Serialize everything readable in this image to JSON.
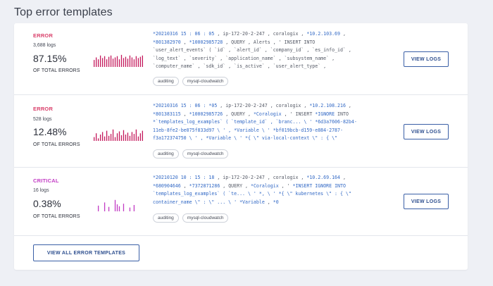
{
  "page": {
    "title": "Top error templates"
  },
  "templates": [
    {
      "severity": "ERROR",
      "severity_class": "error",
      "logs": "3,688 logs",
      "percent": "87.15%",
      "percent_label": "OF TOTAL ERRORS",
      "spark_color": "#c4195c",
      "spark": [
        0.55,
        0.75,
        0.6,
        0.9,
        0.7,
        0.85,
        0.6,
        0.8,
        0.9,
        0.65,
        0.75,
        0.85,
        0.6,
        0.95,
        0.7,
        0.8,
        0.65,
        0.9,
        0.75,
        0.6,
        0.85,
        0.7,
        0.8,
        0.9
      ],
      "message": [
        {
          "t": "*20210316 15 : 06 : 05",
          "h": true
        },
        {
          "t": " , ip-172-20-2-247 , coralogix , ",
          "h": false
        },
        {
          "t": "*10.2.103.69",
          "h": true
        },
        {
          "t": " ,\n",
          "h": false
        },
        {
          "t": "*801382970",
          "h": true
        },
        {
          "t": " , ",
          "h": false
        },
        {
          "t": "*10002985728",
          "h": true
        },
        {
          "t": " , QUERY , Alerts , ' INSERT INTO\n`user_alert_events` ( `id` , `alert_id` , `company_id` , `es_info_id` ,\n`log_text` , `severity` , `application_name` , `subsystem_name` ,\n`computer_name` , `sdk_id` , `is_active` , `user_alert_type` ,",
          "h": false
        }
      ],
      "tags": [
        "auditing",
        "mysql-cloudwatch"
      ],
      "view_label": "VIEW LOGS"
    },
    {
      "severity": "ERROR",
      "severity_class": "error",
      "logs": "528 logs",
      "percent": "12.48%",
      "percent_label": "OF TOTAL ERRORS",
      "spark_color": "#c4195c",
      "spark": [
        0.3,
        0.6,
        0.2,
        0.5,
        0.7,
        0.35,
        0.8,
        0.4,
        0.55,
        0.9,
        0.3,
        0.6,
        0.75,
        0.45,
        0.85,
        0.5,
        0.65,
        0.4,
        0.7,
        0.55,
        0.9,
        0.35,
        0.6,
        0.8
      ],
      "message": [
        {
          "t": "*20210316 15 : 06 : *05",
          "h": true
        },
        {
          "t": " , ip-172-20-2-247 , coralogix , ",
          "h": false
        },
        {
          "t": "*10.2.108.216",
          "h": true
        },
        {
          "t": " ,\n",
          "h": false
        },
        {
          "t": "*801383115",
          "h": true
        },
        {
          "t": " , ",
          "h": false
        },
        {
          "t": "*10002985726",
          "h": true
        },
        {
          "t": " , QUERY , ",
          "h": false
        },
        {
          "t": "*Coralogix",
          "h": true
        },
        {
          "t": " , ' INSERT ",
          "h": false
        },
        {
          "t": "*IGNORE",
          "h": true
        },
        {
          "t": " INTO\n",
          "h": false
        },
        {
          "t": "*`templates_log_examples` ( `template_id` , `branc... \\ ' *6d3a7606-82b4-\n11eb-8fe2-be075f833d97 \\ ' , *Variable \\ ' *bf019bcb-d159-e884-2787-\nf3a172374750 \\ ' , *Variable \\ ' *{ \\\" via-local-context \\\" : { \\\"",
          "h": true
        }
      ],
      "tags": [
        "auditing",
        "mysql-cloudwatch"
      ],
      "view_label": "VIEW LOGS"
    },
    {
      "severity": "CRITICAL",
      "severity_class": "critical",
      "logs": "16 logs",
      "percent": "0.38%",
      "percent_label": "OF TOTAL ERRORS",
      "spark_color": "#c23bc4",
      "spark": [
        0,
        0,
        0.45,
        0,
        0,
        0.7,
        0,
        0.35,
        0,
        0,
        0.9,
        0.55,
        0.4,
        0,
        0.6,
        0,
        0,
        0.3,
        0,
        0.5,
        0,
        0,
        0,
        0
      ],
      "message": [
        {
          "t": "*20210120 10 : 15 : 18",
          "h": true
        },
        {
          "t": " , ip-172-20-2-247 , coralogix , ",
          "h": false
        },
        {
          "t": "*10.2.69.164",
          "h": true
        },
        {
          "t": " ,\n",
          "h": false
        },
        {
          "t": "*680904646",
          "h": true
        },
        {
          "t": " , ",
          "h": false
        },
        {
          "t": "*7372871286",
          "h": true
        },
        {
          "t": " , QUERY , ",
          "h": false
        },
        {
          "t": "*Coralogix",
          "h": true
        },
        {
          "t": " , ' ",
          "h": false
        },
        {
          "t": "*INSERT IGNORE INTO\n`templates_log_examples` ( `te... \\ ' *, \\ ' *{ \\\" kubernetes \\\" : { \\\"\ncontainer_name \\\" : \\\" ... \\ ' *Variable",
          "h": true
        },
        {
          "t": " , ",
          "h": false
        },
        {
          "t": "*0",
          "h": true
        }
      ],
      "tags": [
        "auditing",
        "mysql-cloudwatch"
      ],
      "view_label": "VIEW LOGS"
    }
  ],
  "footer": {
    "view_all_label": "VIEW ALL ERROR TEMPLATES"
  }
}
